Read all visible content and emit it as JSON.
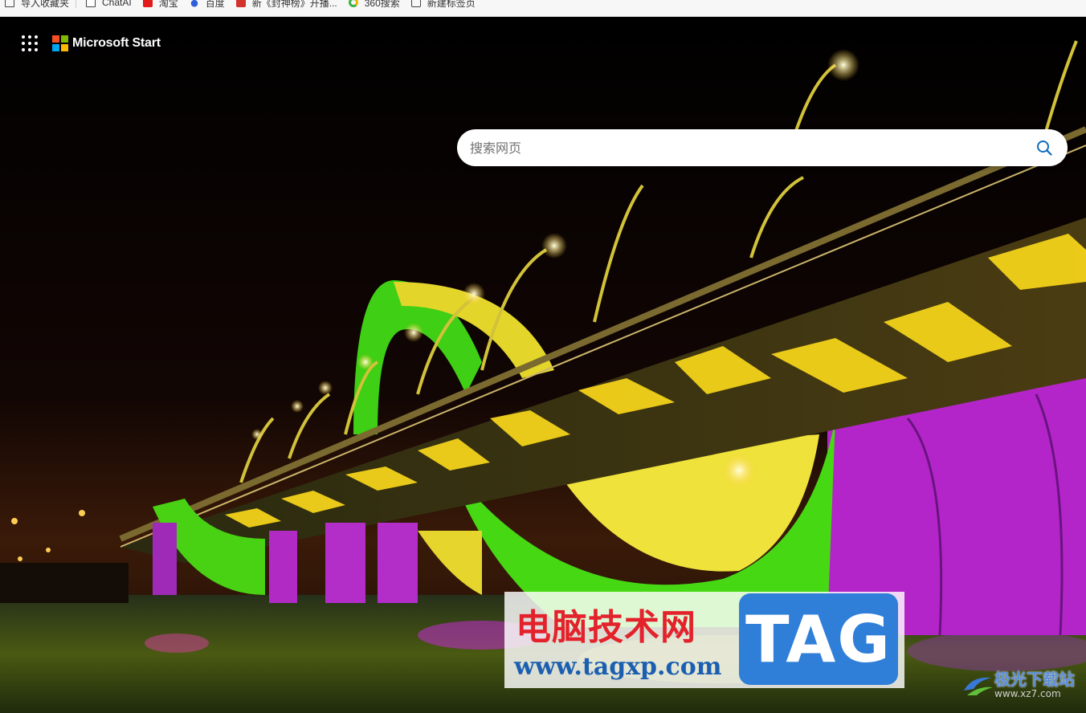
{
  "bookmarks": [
    {
      "label": "导入收藏夹",
      "icon": "import-bookmarks-icon"
    },
    {
      "label": "ChatAI",
      "icon": "document-icon"
    },
    {
      "label": "淘宝",
      "icon": "taobao-icon"
    },
    {
      "label": "百度",
      "icon": "baidu-icon"
    },
    {
      "label": "新《封神榜》开播...",
      "icon": "game-icon"
    },
    {
      "label": "360搜索",
      "icon": "360-search-icon"
    },
    {
      "label": "新建标签页",
      "icon": "new-tab-icon"
    }
  ],
  "header": {
    "brand": "Microsoft Start",
    "apps_icon": "app-launcher-icon",
    "logo_colors": [
      "#f25022",
      "#7fba00",
      "#00a4ef",
      "#ffb900"
    ]
  },
  "search": {
    "placeholder": "搜索网页",
    "icon": "search-icon",
    "icon_color": "#0f6cbd"
  },
  "watermark": {
    "site_cn": "电脑技术网",
    "site_url": "www.tagxp.com",
    "tag": "TAG",
    "corner_cn": "极光下载站",
    "corner_url": "www.xz7.com"
  }
}
